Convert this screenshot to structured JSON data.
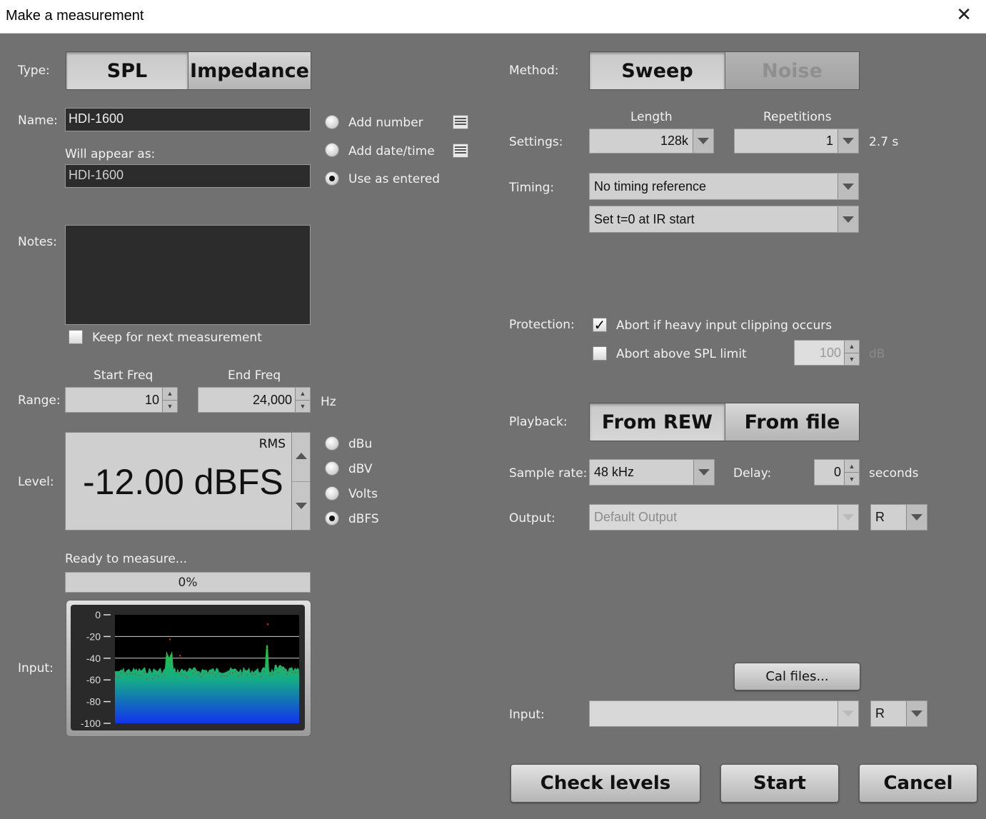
{
  "window": {
    "title": "Make a measurement"
  },
  "type": {
    "label": "Type:",
    "options": [
      "SPL",
      "Impedance"
    ],
    "selected": "SPL"
  },
  "name": {
    "label": "Name:",
    "value": "HDI-1600",
    "appear_label": "Will appear as:",
    "appear_value": "HDI-1600",
    "options": [
      "Add number",
      "Add date/time",
      "Use as entered"
    ],
    "selected": "Use as entered"
  },
  "notes": {
    "label": "Notes:",
    "value": "",
    "keep_label": "Keep for next measurement",
    "keep_checked": false
  },
  "range": {
    "label": "Range:",
    "start_label": "Start Freq",
    "start_value": "10",
    "end_label": "End Freq",
    "end_value": "24,000",
    "unit": "Hz"
  },
  "level": {
    "label": "Level:",
    "mode": "RMS",
    "value": "-12.00 dBFS",
    "units": [
      "dBu",
      "dBV",
      "Volts",
      "dBFS"
    ],
    "selected_unit": "dBFS"
  },
  "status": {
    "text": "Ready to measure...",
    "progress_text": "0%",
    "progress": 0
  },
  "input_meter": {
    "label": "Input:",
    "ticks": [
      "0",
      "-20",
      "-40",
      "-60",
      "-80",
      "-100"
    ]
  },
  "method": {
    "label": "Method:",
    "options": [
      "Sweep",
      "Noise"
    ],
    "selected": "Sweep"
  },
  "settings": {
    "label": "Settings:",
    "length_label": "Length",
    "length_value": "128k",
    "reps_label": "Repetitions",
    "reps_value": "1",
    "duration": "2.7 s"
  },
  "timing": {
    "label": "Timing:",
    "reference": "No timing reference",
    "ir_option": "Set t=0 at IR start"
  },
  "protection": {
    "label": "Protection:",
    "abort_clipping": "Abort if heavy input clipping occurs",
    "abort_clipping_checked": true,
    "abort_spl": "Abort above SPL limit",
    "abort_spl_checked": false,
    "spl_limit": "100",
    "spl_unit": "dB"
  },
  "playback": {
    "label": "Playback:",
    "options": [
      "From REW",
      "From file"
    ],
    "selected": "From REW"
  },
  "sample_rate": {
    "label": "Sample rate:",
    "value": "48 kHz"
  },
  "delay": {
    "label": "Delay:",
    "value": "0",
    "unit": "seconds"
  },
  "output": {
    "label": "Output:",
    "device": "Default Output",
    "channel": "R"
  },
  "cal_button": "Cal files...",
  "input": {
    "label": "Input:",
    "device": "",
    "channel": "R"
  },
  "buttons": {
    "check_levels": "Check levels",
    "start": "Start",
    "cancel": "Cancel"
  },
  "colors": {
    "background": "#717171",
    "spectrum_top": "#22cc33",
    "spectrum_bottom": "#1133ee",
    "peak_marker": "#ff2020"
  }
}
